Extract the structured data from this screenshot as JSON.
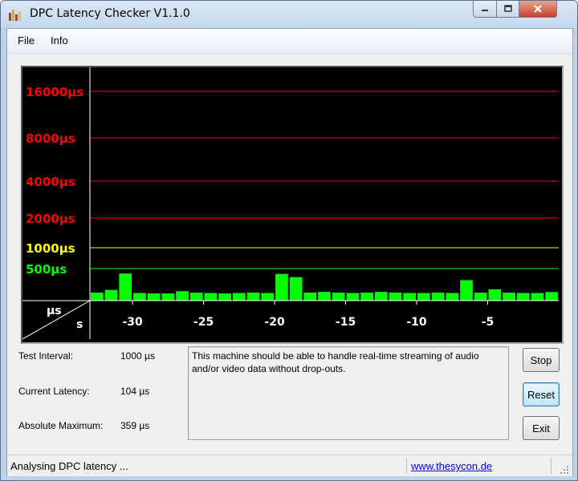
{
  "window": {
    "title": "DPC Latency Checker V1.1.0"
  },
  "menu": {
    "file": "File",
    "info": "Info"
  },
  "colors": {
    "window_frame": "#bcd3ea",
    "graph_bg": "#000000",
    "bar": "#00ff00",
    "red_line": "#ff0000",
    "yellow_line": "#ffff00",
    "green_line": "#00ff00"
  },
  "icons": {
    "app": "bar-chart-icon",
    "minimize": "minimize-icon",
    "maximize": "maximize-icon",
    "close": "close-icon",
    "grip": "resize-grip-icon"
  },
  "chart_data": {
    "type": "bar",
    "y_unit_label": "µs",
    "x_unit_label": "s",
    "y_scale": "log",
    "thresholds": [
      {
        "label": "16000µs",
        "value": 16000,
        "color": "#ff0000"
      },
      {
        "label": "8000µs",
        "value": 8000,
        "color": "#ff0000"
      },
      {
        "label": "4000µs",
        "value": 4000,
        "color": "#ff0000"
      },
      {
        "label": "2000µs",
        "value": 2000,
        "color": "#ff0000"
      },
      {
        "label": "1000µs",
        "value": 1000,
        "color": "#ffff00"
      },
      {
        "label": "500µs",
        "value": 500,
        "color": "#00ff00"
      }
    ],
    "x_ticks": [
      -30,
      -25,
      -20,
      -15,
      -10,
      -5
    ],
    "x_tick_labels": [
      "-30",
      "-25",
      "-20",
      "-15",
      "-10",
      "-5"
    ],
    "xlim": [
      -33,
      0
    ],
    "x": [
      -33,
      -32,
      -31,
      -30,
      -29,
      -28,
      -27,
      -26,
      -25,
      -24,
      -23,
      -22,
      -21,
      -20,
      -19,
      -18,
      -17,
      -16,
      -15,
      -14,
      -13,
      -12,
      -11,
      -10,
      -9,
      -8,
      -7,
      -6,
      -5,
      -4,
      -3,
      -2,
      -1
    ],
    "values": [
      100,
      120,
      359,
      95,
      90,
      90,
      110,
      100,
      95,
      90,
      95,
      100,
      95,
      350,
      280,
      100,
      105,
      100,
      95,
      100,
      105,
      100,
      95,
      95,
      100,
      95,
      230,
      100,
      125,
      100,
      95,
      95,
      104
    ]
  },
  "info": {
    "test_interval_label": "Test Interval:",
    "test_interval_value": "1000 µs",
    "current_latency_label": "Current Latency:",
    "current_latency_value": "104 µs",
    "absolute_max_label": "Absolute Maximum:",
    "absolute_max_value": "359 µs"
  },
  "message": "This machine should be able to handle real-time streaming of audio and/or video data without drop-outs.",
  "buttons": {
    "stop": "Stop",
    "reset": "Reset",
    "exit": "Exit"
  },
  "status": {
    "text": "Analysing DPC latency ...",
    "link": "www.thesycon.de"
  }
}
